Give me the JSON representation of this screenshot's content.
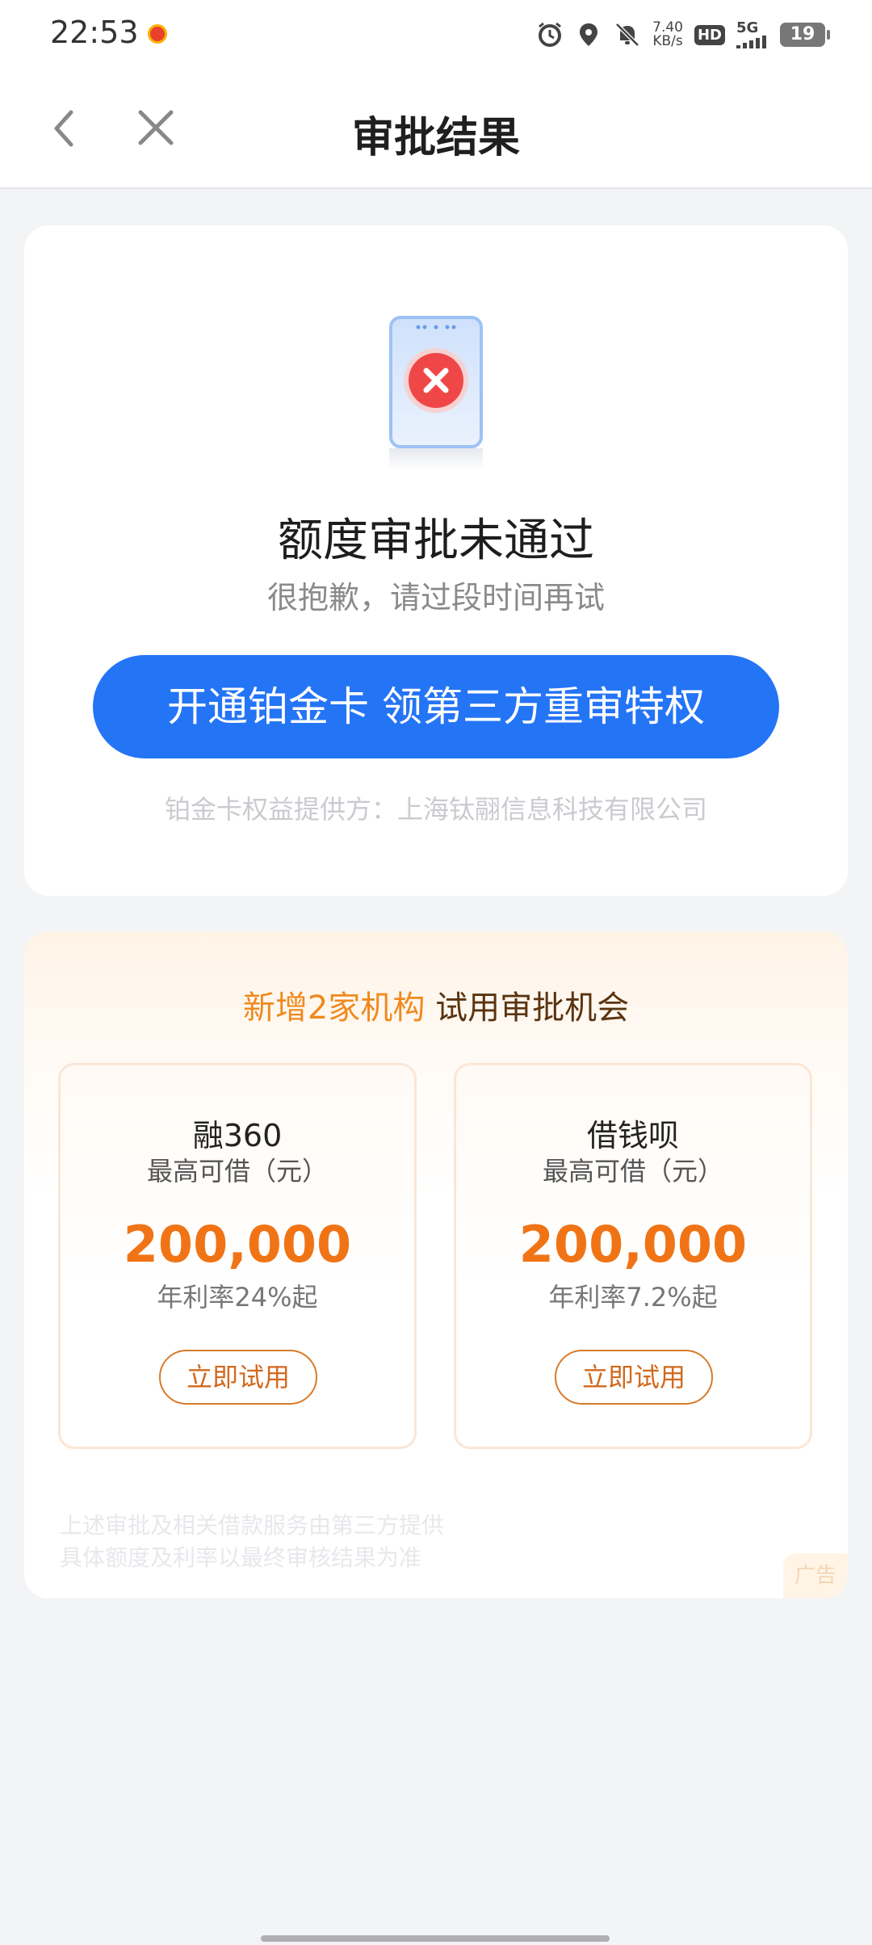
{
  "status_bar": {
    "time": "22:53",
    "net_speed_value": "7.40",
    "net_speed_unit": "KB/s",
    "hd_label": "HD",
    "network_label": "5G",
    "battery_level": "19"
  },
  "nav": {
    "title": "审批结果"
  },
  "result": {
    "title": "额度审批未通过",
    "subtitle": "很抱歉，请过段时间再试",
    "cta_label": "开通铂金卡 领第三方重审特权",
    "provider_note": "铂金卡权益提供方：上海钛翮信息科技有限公司"
  },
  "offers": {
    "header_highlight": "新增2家机构",
    "header_rest": "试用审批机会",
    "items": [
      {
        "name": "融360",
        "label": "最高可借（元）",
        "amount": "200,000",
        "rate": "年利率24%起",
        "button": "立即试用"
      },
      {
        "name": "借钱呗",
        "label": "最高可借（元）",
        "amount": "200,000",
        "rate": "年利率7.2%起",
        "button": "立即试用"
      }
    ],
    "disclaimer_line1": "上述审批及相关借款服务由第三方提供",
    "disclaimer_line2": "具体额度及利率以最终审核结果为准",
    "ad_label": "广告"
  },
  "colors": {
    "primary_blue": "#2474f6",
    "accent_orange": "#f07416",
    "error_red": "#ef4747"
  },
  "icons": {
    "back": "chevron-left-icon",
    "close": "close-icon",
    "result_illustration": "phone-error-icon"
  }
}
